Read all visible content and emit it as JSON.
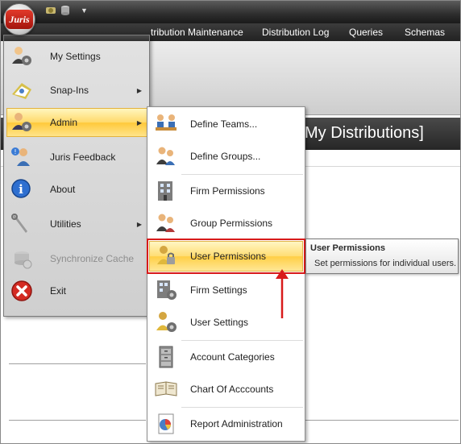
{
  "app": {
    "logo_text": "Juris"
  },
  "ribbon": {
    "tabs": [
      {
        "label": "tribution Maintenance"
      },
      {
        "label": "Distribution Log"
      },
      {
        "label": "Queries"
      },
      {
        "label": "Schemas"
      }
    ]
  },
  "page": {
    "heading": "My Distributions]"
  },
  "app_menu": {
    "items": [
      {
        "label": "My Settings",
        "icon": "settings-user-icon"
      },
      {
        "label": "Snap-Ins",
        "icon": "snap-ins-icon",
        "has_submenu": true
      },
      {
        "label": "Admin",
        "icon": "admin-icon",
        "has_submenu": true,
        "selected": true
      },
      {
        "label": "Juris Feedback",
        "icon": "feedback-icon"
      },
      {
        "label": "About",
        "icon": "info-icon"
      },
      {
        "label": "Utilities",
        "icon": "utilities-icon",
        "has_submenu": true
      },
      {
        "label": "Synchronize Cache",
        "icon": "sync-icon",
        "disabled": true
      },
      {
        "label": "Exit",
        "icon": "exit-icon"
      }
    ],
    "submenu_arrow": "▶"
  },
  "admin_submenu": {
    "items": [
      {
        "label": "Define Teams...",
        "icon": "teams-icon"
      },
      {
        "label": "Define Groups...",
        "icon": "groups-icon"
      },
      {
        "label": "Firm Permissions",
        "icon": "building-icon"
      },
      {
        "label": "Group Permissions",
        "icon": "group-permissions-icon"
      },
      {
        "label": "User Permissions",
        "icon": "user-lock-icon",
        "selected": true
      },
      {
        "label": "Firm Settings",
        "icon": "building-gear-icon"
      },
      {
        "label": "User Settings",
        "icon": "user-gear-icon"
      },
      {
        "label": "Account Categories",
        "icon": "filing-cabinet-icon"
      },
      {
        "label": "Chart Of Acccounts",
        "icon": "ledger-book-icon"
      },
      {
        "label": "Report Administration",
        "icon": "report-chart-icon"
      }
    ]
  },
  "tooltip": {
    "title": "User Permissions",
    "description": "Set permissions for individual users."
  },
  "colors": {
    "highlight": "#ffd96a",
    "callout_red": "#d81b1b",
    "titlebar_dark": "#2d2d2d"
  }
}
